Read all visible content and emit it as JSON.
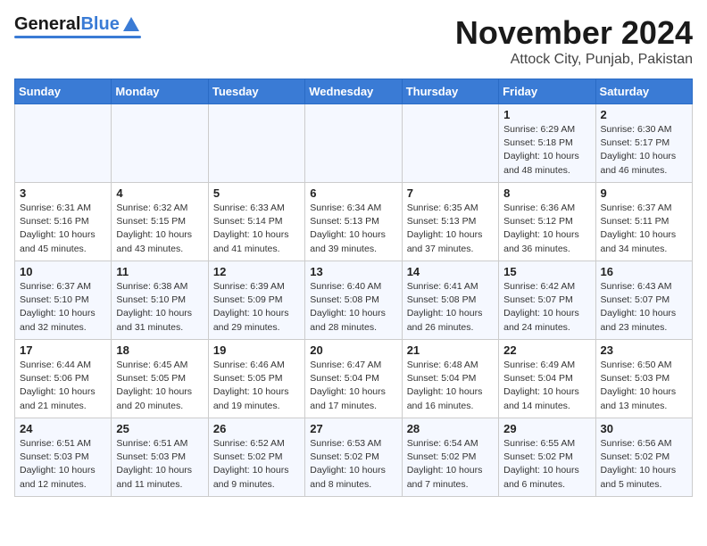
{
  "header": {
    "logo_general": "General",
    "logo_blue": "Blue",
    "month": "November 2024",
    "location": "Attock City, Punjab, Pakistan"
  },
  "weekdays": [
    "Sunday",
    "Monday",
    "Tuesday",
    "Wednesday",
    "Thursday",
    "Friday",
    "Saturday"
  ],
  "weeks": [
    [
      {
        "day": "",
        "info": ""
      },
      {
        "day": "",
        "info": ""
      },
      {
        "day": "",
        "info": ""
      },
      {
        "day": "",
        "info": ""
      },
      {
        "day": "",
        "info": ""
      },
      {
        "day": "1",
        "info": "Sunrise: 6:29 AM\nSunset: 5:18 PM\nDaylight: 10 hours\nand 48 minutes."
      },
      {
        "day": "2",
        "info": "Sunrise: 6:30 AM\nSunset: 5:17 PM\nDaylight: 10 hours\nand 46 minutes."
      }
    ],
    [
      {
        "day": "3",
        "info": "Sunrise: 6:31 AM\nSunset: 5:16 PM\nDaylight: 10 hours\nand 45 minutes."
      },
      {
        "day": "4",
        "info": "Sunrise: 6:32 AM\nSunset: 5:15 PM\nDaylight: 10 hours\nand 43 minutes."
      },
      {
        "day": "5",
        "info": "Sunrise: 6:33 AM\nSunset: 5:14 PM\nDaylight: 10 hours\nand 41 minutes."
      },
      {
        "day": "6",
        "info": "Sunrise: 6:34 AM\nSunset: 5:13 PM\nDaylight: 10 hours\nand 39 minutes."
      },
      {
        "day": "7",
        "info": "Sunrise: 6:35 AM\nSunset: 5:13 PM\nDaylight: 10 hours\nand 37 minutes."
      },
      {
        "day": "8",
        "info": "Sunrise: 6:36 AM\nSunset: 5:12 PM\nDaylight: 10 hours\nand 36 minutes."
      },
      {
        "day": "9",
        "info": "Sunrise: 6:37 AM\nSunset: 5:11 PM\nDaylight: 10 hours\nand 34 minutes."
      }
    ],
    [
      {
        "day": "10",
        "info": "Sunrise: 6:37 AM\nSunset: 5:10 PM\nDaylight: 10 hours\nand 32 minutes."
      },
      {
        "day": "11",
        "info": "Sunrise: 6:38 AM\nSunset: 5:10 PM\nDaylight: 10 hours\nand 31 minutes."
      },
      {
        "day": "12",
        "info": "Sunrise: 6:39 AM\nSunset: 5:09 PM\nDaylight: 10 hours\nand 29 minutes."
      },
      {
        "day": "13",
        "info": "Sunrise: 6:40 AM\nSunset: 5:08 PM\nDaylight: 10 hours\nand 28 minutes."
      },
      {
        "day": "14",
        "info": "Sunrise: 6:41 AM\nSunset: 5:08 PM\nDaylight: 10 hours\nand 26 minutes."
      },
      {
        "day": "15",
        "info": "Sunrise: 6:42 AM\nSunset: 5:07 PM\nDaylight: 10 hours\nand 24 minutes."
      },
      {
        "day": "16",
        "info": "Sunrise: 6:43 AM\nSunset: 5:07 PM\nDaylight: 10 hours\nand 23 minutes."
      }
    ],
    [
      {
        "day": "17",
        "info": "Sunrise: 6:44 AM\nSunset: 5:06 PM\nDaylight: 10 hours\nand 21 minutes."
      },
      {
        "day": "18",
        "info": "Sunrise: 6:45 AM\nSunset: 5:05 PM\nDaylight: 10 hours\nand 20 minutes."
      },
      {
        "day": "19",
        "info": "Sunrise: 6:46 AM\nSunset: 5:05 PM\nDaylight: 10 hours\nand 19 minutes."
      },
      {
        "day": "20",
        "info": "Sunrise: 6:47 AM\nSunset: 5:04 PM\nDaylight: 10 hours\nand 17 minutes."
      },
      {
        "day": "21",
        "info": "Sunrise: 6:48 AM\nSunset: 5:04 PM\nDaylight: 10 hours\nand 16 minutes."
      },
      {
        "day": "22",
        "info": "Sunrise: 6:49 AM\nSunset: 5:04 PM\nDaylight: 10 hours\nand 14 minutes."
      },
      {
        "day": "23",
        "info": "Sunrise: 6:50 AM\nSunset: 5:03 PM\nDaylight: 10 hours\nand 13 minutes."
      }
    ],
    [
      {
        "day": "24",
        "info": "Sunrise: 6:51 AM\nSunset: 5:03 PM\nDaylight: 10 hours\nand 12 minutes."
      },
      {
        "day": "25",
        "info": "Sunrise: 6:51 AM\nSunset: 5:03 PM\nDaylight: 10 hours\nand 11 minutes."
      },
      {
        "day": "26",
        "info": "Sunrise: 6:52 AM\nSunset: 5:02 PM\nDaylight: 10 hours\nand 9 minutes."
      },
      {
        "day": "27",
        "info": "Sunrise: 6:53 AM\nSunset: 5:02 PM\nDaylight: 10 hours\nand 8 minutes."
      },
      {
        "day": "28",
        "info": "Sunrise: 6:54 AM\nSunset: 5:02 PM\nDaylight: 10 hours\nand 7 minutes."
      },
      {
        "day": "29",
        "info": "Sunrise: 6:55 AM\nSunset: 5:02 PM\nDaylight: 10 hours\nand 6 minutes."
      },
      {
        "day": "30",
        "info": "Sunrise: 6:56 AM\nSunset: 5:02 PM\nDaylight: 10 hours\nand 5 minutes."
      }
    ]
  ]
}
